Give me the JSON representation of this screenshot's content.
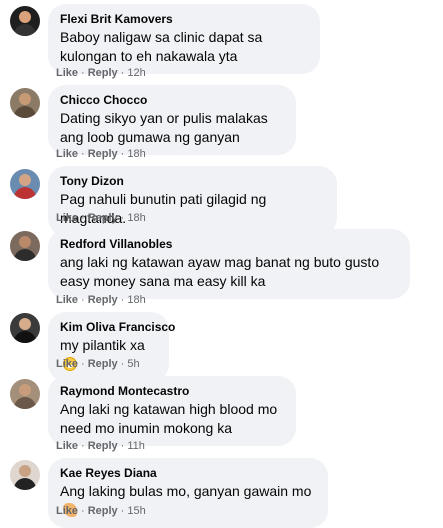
{
  "actions": {
    "like": "Like",
    "reply": "Reply",
    "separator": "·"
  },
  "comments": [
    {
      "author": "Flexi Brit Kamovers",
      "text": "Baboy naligaw sa clinic dapat sa kulongan to eh nakawala yta",
      "time": "12h"
    },
    {
      "author": "Chicco Chocco",
      "text": "Dating sikyo yan or pulis malakas ang loob gumawa ng ganyan",
      "time": "18h"
    },
    {
      "author": "Tony Dizon",
      "text": "Pag nahuli bunutin pati gilagid ng magtanda.",
      "time": "18h"
    },
    {
      "author": "Redford Villanobles",
      "text": "ang laki ng katawan ayaw mag banat ng buto gusto easy money sana ma easy kill ka",
      "time": "18h"
    },
    {
      "author": "Kim Oliva Francisco",
      "text": "my pilantik xa",
      "emoji": "grinning-sweat-emoji",
      "time": "5h"
    },
    {
      "author": "Raymond Montecastro",
      "text": "Ang laki ng katawan high blood mo need mo inumin mokong ka",
      "time": "11h"
    },
    {
      "author": "Kae Reyes Diana",
      "text": "Ang laking bulas mo, ganyan gawain mo",
      "emoji": "flexed-biceps-emoji",
      "time": "15h"
    }
  ]
}
